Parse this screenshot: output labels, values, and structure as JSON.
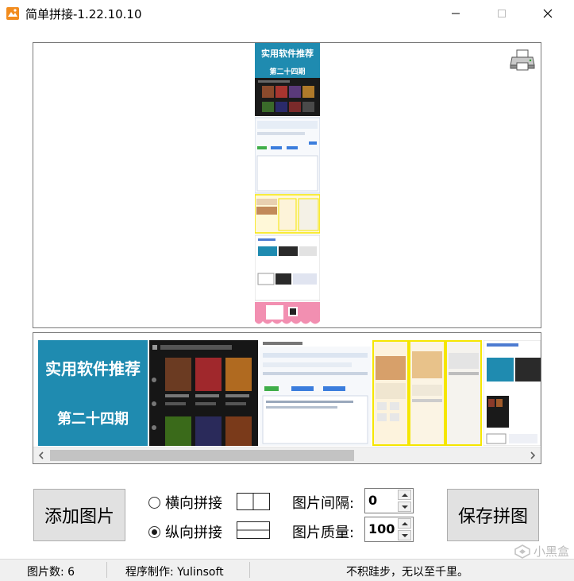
{
  "window": {
    "title": "简单拼接-1.22.10.10",
    "controls": [
      "minimize",
      "maximize",
      "close"
    ]
  },
  "colors": {
    "accent_banner": "#1f8bb0",
    "highlight_yellow": "#f5e600",
    "button_face": "#e1e1e1",
    "pink_footer": "#f28fb1"
  },
  "preview": {
    "banner_title": "实用软件推荐",
    "banner_subtitle": "第二十四期",
    "print_icon": "printer-icon"
  },
  "strip": {
    "banner_title": "实用软件推荐",
    "banner_subtitle": "第二十四期"
  },
  "controls": {
    "add_button": "添加图片",
    "save_button": "保存拼图",
    "horizontal_label": "横向拼接",
    "vertical_label": "纵向拼接",
    "selected_mode": "vertical",
    "spacing_label": "图片间隔:",
    "spacing_value": "0",
    "quality_label": "图片质量:",
    "quality_value": "100"
  },
  "status": {
    "count": "图片数: 6",
    "author": "程序制作: Yulinsoft",
    "motto": "不积跬步，无以至千里。"
  },
  "watermark": {
    "text": "小黑盒"
  }
}
